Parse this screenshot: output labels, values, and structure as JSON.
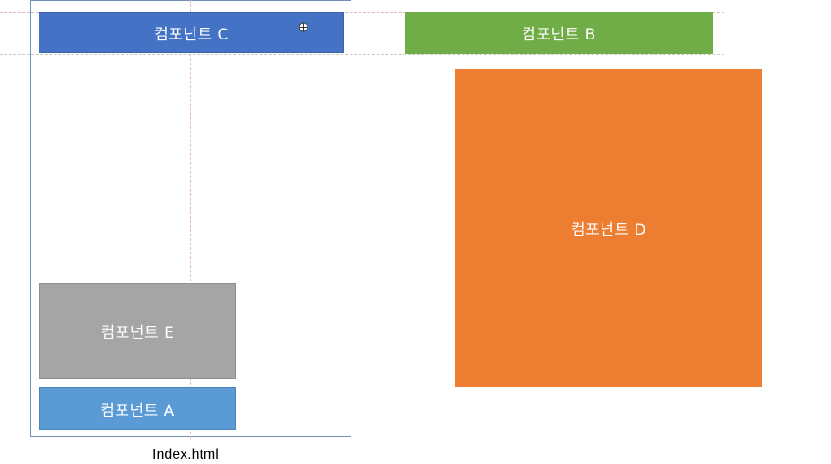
{
  "components": {
    "c_label": "컴포넌트 C",
    "b_label": "컴포넌트 B",
    "d_label": "컴포넌트 D",
    "e_label": "컴포넌트 E",
    "a_label": "컴포넌트 A"
  },
  "frame_caption": "Index.html",
  "colors": {
    "component_c": "#4472c4",
    "component_b": "#70ad47",
    "component_d": "#ed7d31",
    "component_e": "#a5a5a5",
    "component_a": "#5b9bd5",
    "frame_border": "#6f8fb8",
    "guide_line": "#e0b8b8"
  },
  "icons": {
    "cursor": "move-cursor-icon"
  }
}
